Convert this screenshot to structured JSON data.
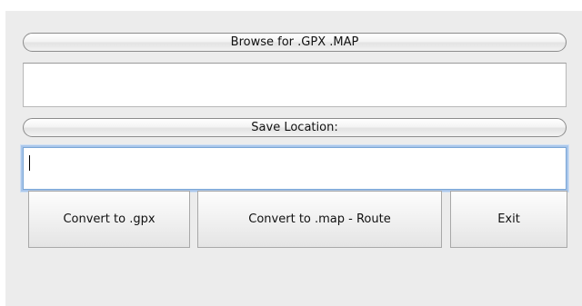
{
  "form": {
    "browse_button": "Browse for .GPX .MAP",
    "source_path_value": "",
    "save_location_button": "Save Location:",
    "save_path_value": ""
  },
  "actions": {
    "convert_gpx": "Convert to .gpx",
    "convert_map": "Convert to .map - Route",
    "exit": "Exit"
  },
  "colors": {
    "window_background": "#ececec",
    "focus_ring": "#a9c6ea"
  }
}
